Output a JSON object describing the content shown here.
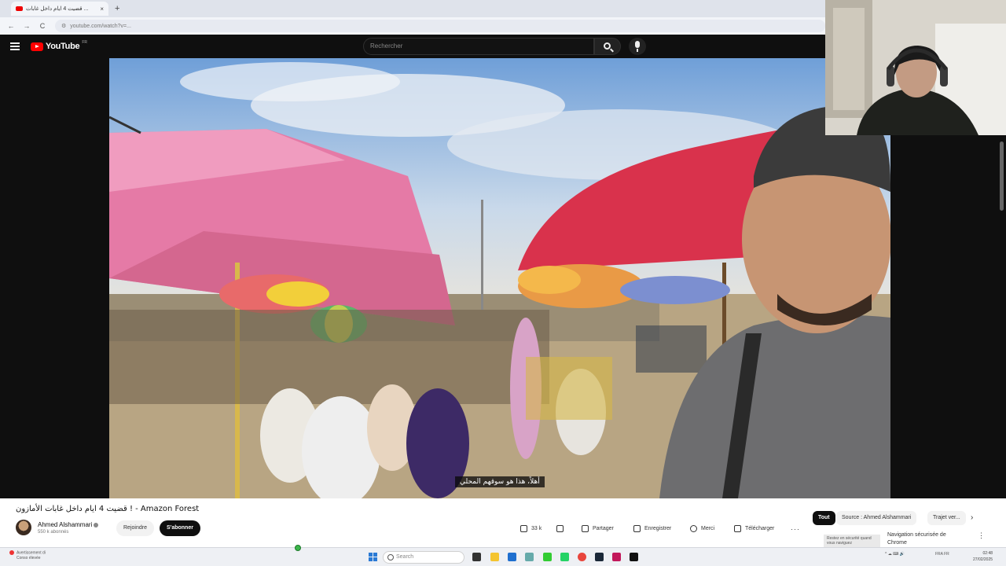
{
  "browser": {
    "tab_title": "قضيت 4 ايام داخل غابات ...",
    "tab_close": "×",
    "new_tab": "+",
    "url": "youtube.com/watch?v=...",
    "back": "←",
    "forward": "→",
    "reload": "C"
  },
  "header": {
    "logo_text": "YouTube",
    "country_code": "FR",
    "search_placeholder": "Rechercher"
  },
  "video": {
    "subtitle": "أهلاً، هذا هو سوقهم المحلي",
    "title": "قضيت 4 ايام داخل غابات الأمازون ! - Amazon Forest"
  },
  "channel": {
    "name": "Ahmed Alshammari",
    "subscribers": "550 k abonnés",
    "join_label": "Rejoindre",
    "subscribe_label": "S'abonner"
  },
  "actions": {
    "likes": "33 k",
    "share": "Partager",
    "save": "Enregistrer",
    "thanks": "Merci",
    "download": "Télécharger",
    "more": "···"
  },
  "recommendations": {
    "chips": [
      "Tout",
      "Source : Ahmed Alshammari",
      "Trajet ver..."
    ],
    "chevron": "›",
    "ad_thumb": "Restez en sécurité quand vous naviguez",
    "ad_title": "Navigation sécurisée de Chrome",
    "kebab": "⋮"
  },
  "taskbar": {
    "notice_line1": "Avertissement di",
    "notice_line2": "Conso élevée",
    "search": "Search",
    "tray": "^  ☁  ⌨  🔊",
    "lang": "FRA FR",
    "time": "02:48",
    "date": "27/02/2025"
  },
  "colors": {
    "yt_red": "#ff0000",
    "subscribe_bg": "#0f0f0f",
    "page_bg": "#0f0f0f"
  }
}
